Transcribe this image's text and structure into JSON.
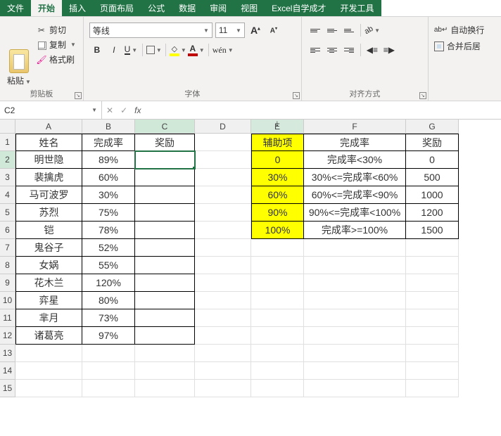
{
  "tabs": {
    "file": "文件",
    "home": "开始",
    "insert": "插入",
    "pageLayout": "页面布局",
    "formulas": "公式",
    "data": "数据",
    "review": "审阅",
    "view": "视图",
    "custom1": "Excel自学成才",
    "developer": "开发工具"
  },
  "ribbon": {
    "clipboard": {
      "label": "剪贴板",
      "paste": "粘贴",
      "cut": "剪切",
      "copy": "复制",
      "formatPainter": "格式刷"
    },
    "font": {
      "label": "字体",
      "fontName": "等线",
      "fontSize": "11",
      "bold": "B",
      "italic": "I",
      "underline": "U",
      "wen": "wén"
    },
    "align": {
      "label": "对齐方式",
      "wrap": "自动换行",
      "merge": "合并后居"
    }
  },
  "formulaBar": {
    "nameBox": "C2",
    "value": ""
  },
  "columns": [
    "A",
    "B",
    "C",
    "D",
    "E",
    "F",
    "G"
  ],
  "rows": [
    "1",
    "2",
    "3",
    "4",
    "5",
    "6",
    "7",
    "8",
    "9",
    "10",
    "11",
    "12",
    "13",
    "14",
    "15"
  ],
  "table1": {
    "headers": {
      "name": "姓名",
      "rate": "完成率",
      "reward": "奖励"
    },
    "rows": [
      {
        "name": "明世隐",
        "rate": "89%",
        "reward": ""
      },
      {
        "name": "裴擒虎",
        "rate": "60%",
        "reward": ""
      },
      {
        "name": "马可波罗",
        "rate": "30%",
        "reward": ""
      },
      {
        "name": "苏烈",
        "rate": "75%",
        "reward": ""
      },
      {
        "name": "铠",
        "rate": "78%",
        "reward": ""
      },
      {
        "name": "鬼谷子",
        "rate": "52%",
        "reward": ""
      },
      {
        "name": "女娲",
        "rate": "55%",
        "reward": ""
      },
      {
        "name": "花木兰",
        "rate": "120%",
        "reward": ""
      },
      {
        "name": "弈星",
        "rate": "80%",
        "reward": ""
      },
      {
        "name": "芈月",
        "rate": "73%",
        "reward": ""
      },
      {
        "name": "诸葛亮",
        "rate": "97%",
        "reward": ""
      }
    ]
  },
  "table2": {
    "headers": {
      "aux": "辅助项",
      "rate": "完成率",
      "reward": "奖励"
    },
    "rows": [
      {
        "aux": "0",
        "rate": "完成率<30%",
        "reward": "0"
      },
      {
        "aux": "30%",
        "rate": "30%<=完成率<60%",
        "reward": "500"
      },
      {
        "aux": "60%",
        "rate": "60%<=完成率<90%",
        "reward": "1000"
      },
      {
        "aux": "90%",
        "rate": "90%<=完成率<100%",
        "reward": "1200"
      },
      {
        "aux": "100%",
        "rate": "完成率>=100%",
        "reward": "1500"
      }
    ]
  }
}
